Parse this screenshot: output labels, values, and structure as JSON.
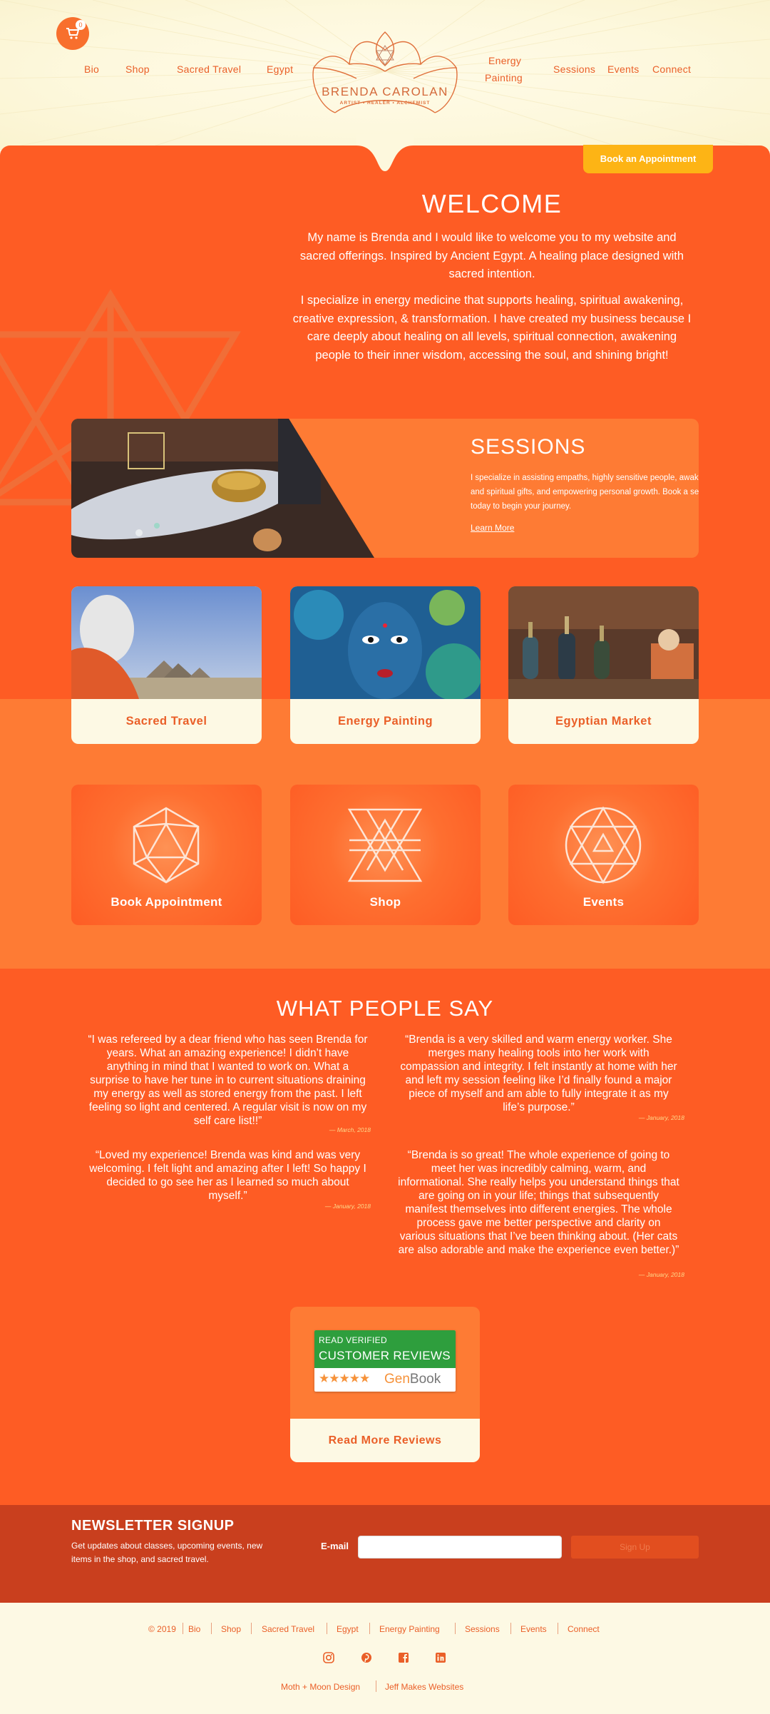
{
  "header": {
    "cart_count": "0",
    "nav_left": [
      "Bio",
      "Shop",
      "Sacred Travel",
      "Egypt"
    ],
    "nav_energy_line1": "Energy",
    "nav_energy_line2": "Painting",
    "nav_right": [
      "Sessions",
      "Events",
      "Connect"
    ],
    "logo_name": "BRENDA CAROLAN",
    "logo_tagline": "ARTIST • HEALER • ALCHEMIST",
    "book_button": "Book an Appointment"
  },
  "welcome": {
    "title": "WELCOME",
    "paragraph1": "My name is Brenda and I would like to welcome you to my website and sacred offerings. Inspired by Ancient Egypt. A healing place designed with sacred intention.",
    "paragraph2": "I specialize in energy medicine that supports healing, spiritual awakening, creative expression, & transformation. I have created my business because I care deeply about healing on all levels, spiritual connection, awakening people to their inner wisdom, accessing the soul, and shining bright!"
  },
  "sessions": {
    "title": "SESSIONS",
    "text": "I specialize in assisting empaths, highly sensitive people, awakening intuitive and spiritual gifts, and empowering personal growth. Book a session with me today to begin your journey.",
    "link": "Learn More"
  },
  "photo_cards": [
    "Sacred Travel",
    "Energy Painting",
    "Egyptian Market"
  ],
  "icon_cards": [
    "Book Appointment",
    "Shop",
    "Events"
  ],
  "testimonials": {
    "title": "WHAT PEOPLE SAY",
    "items": [
      {
        "quote": "“I was refereed by a dear friend who has seen Brenda for years. What an amazing experience! I didn’t have anything in mind that I wanted to work on. What a surprise to have her tune in to current situations draining my energy as well as stored energy from the past. I left feeling so light and centered. A regular visit is now on my self care list!!”",
        "date": "— March, 2018"
      },
      {
        "quote": "“Brenda is a very skilled and warm energy worker. She merges many healing tools into her work with compassion and integrity. I felt instantly at home with her and left my session feeling like I’d finally found a major piece of myself and am able to fully integrate it as my life’s purpose.”",
        "date": "— January, 2018"
      },
      {
        "quote": "“Loved my experience! Brenda was kind and was very welcoming. I felt light and amazing after I left! So happy I decided to go see her as I learned so much about myself.”",
        "date": "— January, 2018"
      },
      {
        "quote": "“Brenda is so great! The whole experience of going to meet her was incredibly calming, warm, and informational. She really helps you understand things that are going on in your life; things that subsequently manifest themselves into different energies. The whole process gave me better perspective and clarity on various situations that I’ve been thinking about. (Her cats are also adorable and make the experience even better.)”",
        "date": "— January, 2018"
      }
    ],
    "badge_line1": "READ VERIFIED",
    "badge_line2": "CUSTOMER REVIEWS",
    "badge_stars": "★★★★★",
    "badge_brand_a": "Gen",
    "badge_brand_b": "Book",
    "read_more": "Read More Reviews"
  },
  "newsletter": {
    "title": "NEWSLETTER SIGNUP",
    "text": "Get updates about classes, upcoming events, new items in the shop, and sacred travel.",
    "email_label": "E-mail",
    "email_value": "",
    "signup_label": "Sign Up"
  },
  "footer": {
    "copyright": "© 2019",
    "links": [
      "Bio",
      "Shop",
      "Sacred Travel",
      "Egypt",
      "Energy Painting",
      "Sessions",
      "Events",
      "Connect"
    ],
    "social": [
      "instagram-icon",
      "pinterest-icon",
      "facebook-icon",
      "linkedin-icon"
    ],
    "credit1": "Moth + Moon Design",
    "credit2": "Jeff Makes Websites"
  },
  "colors": {
    "orange": "#fe5c24",
    "orange_light": "#fe7b34",
    "cream": "#fdf9e4",
    "gold": "#fdb415",
    "deep": "#c93f1e"
  }
}
